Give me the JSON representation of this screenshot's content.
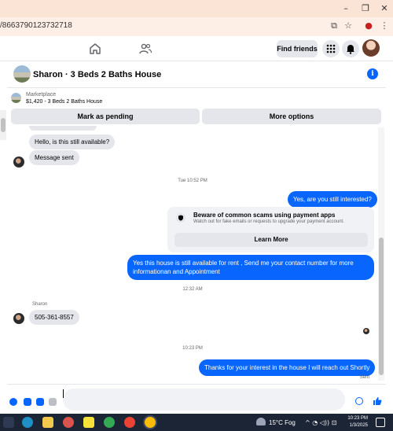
{
  "browser": {
    "url_fragment": "/8663790123732718",
    "minimize": "–",
    "maximize": "❐",
    "close": "✕"
  },
  "nav": {
    "find_friends": "Find friends"
  },
  "chat": {
    "title": "Sharon · 3 Beds 2 Baths House",
    "listing_source": "Marketplace",
    "listing_price": "$1,420 - 3 Beds 2 Baths House",
    "mark_pending": "Mark as pending",
    "more_options": "More options"
  },
  "messages": {
    "m1": "Hello, is this still available?",
    "m2": "Message sent",
    "ts1": "Tue 10:52 PM",
    "m3": "Yes, are you still interested?",
    "warn_title": "Beware of common scams using payment apps",
    "warn_text": "Watch out for fake emails or requests to upgrade your payment account.",
    "learn_more": "Learn More",
    "m4_line1": "Yes this house is still available for rent , Send me your contact number for more",
    "m4_line2": "informationan and Appointment",
    "ts2": "12:32 AM",
    "sender": "Sharon",
    "m5": "505-361-8557",
    "ts3": "10:23 PM",
    "m6": "Thanks for your interest in the house I will reach out Shortly",
    "status": "Sent"
  },
  "taskbar": {
    "weather": "15°C  Fog",
    "time": "10:23 PM",
    "date": "1/3/2025"
  },
  "colors": {
    "accent": "#0866ff",
    "bubble_in": "#e4e6eb",
    "titlebar": "#fbe3d6"
  }
}
